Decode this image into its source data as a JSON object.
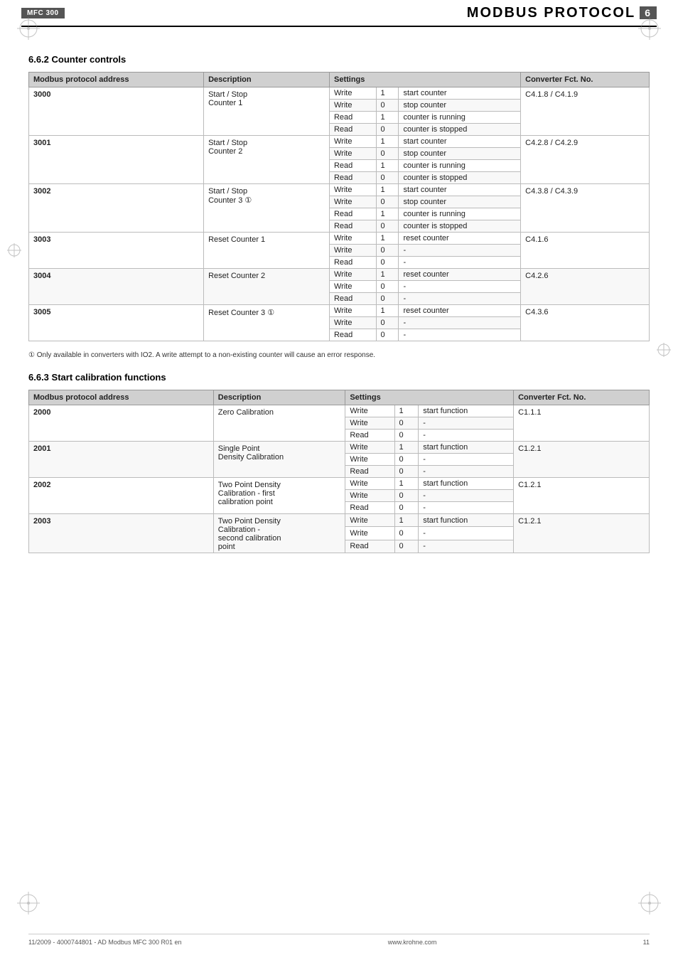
{
  "header": {
    "product": "MFC 300",
    "title": "MODBUS PROTOCOL",
    "badge": "6"
  },
  "section1": {
    "heading": "6.6.2  Counter controls",
    "table": {
      "columns": [
        "Modbus protocol address",
        "Description",
        "Settings",
        "",
        "",
        "Converter Fct. No."
      ],
      "rows": [
        {
          "address": "3000",
          "description": "Start / Stop\nCounter 1",
          "rows_inner": [
            {
              "rw": "Write",
              "val": "1",
              "desc": "start counter",
              "fct": "C4.1.8 / C4.1.9"
            },
            {
              "rw": "Write",
              "val": "0",
              "desc": "stop counter",
              "fct": ""
            },
            {
              "rw": "Read",
              "val": "1",
              "desc": "counter is running",
              "fct": ""
            },
            {
              "rw": "Read",
              "val": "0",
              "desc": "counter is stopped",
              "fct": ""
            }
          ]
        },
        {
          "address": "3001",
          "description": "Start / Stop\nCounter 2",
          "rows_inner": [
            {
              "rw": "Write",
              "val": "1",
              "desc": "start counter",
              "fct": "C4.2.8 / C4.2.9"
            },
            {
              "rw": "Write",
              "val": "0",
              "desc": "stop counter",
              "fct": ""
            },
            {
              "rw": "Read",
              "val": "1",
              "desc": "counter is running",
              "fct": ""
            },
            {
              "rw": "Read",
              "val": "0",
              "desc": "counter is stopped",
              "fct": ""
            }
          ]
        },
        {
          "address": "3002",
          "description": "Start / Stop\nCounter 3 ①",
          "rows_inner": [
            {
              "rw": "Write",
              "val": "1",
              "desc": "start counter",
              "fct": "C4.3.8 / C4.3.9"
            },
            {
              "rw": "Write",
              "val": "0",
              "desc": "stop counter",
              "fct": ""
            },
            {
              "rw": "Read",
              "val": "1",
              "desc": "counter is running",
              "fct": ""
            },
            {
              "rw": "Read",
              "val": "0",
              "desc": "counter is stopped",
              "fct": ""
            }
          ]
        },
        {
          "address": "3003",
          "description": "Reset Counter 1",
          "rows_inner": [
            {
              "rw": "Write",
              "val": "1",
              "desc": "reset counter",
              "fct": "C4.1.6"
            },
            {
              "rw": "Write",
              "val": "0",
              "desc": "-",
              "fct": ""
            },
            {
              "rw": "Read",
              "val": "0",
              "desc": "-",
              "fct": ""
            }
          ]
        },
        {
          "address": "3004",
          "description": "Reset Counter 2",
          "rows_inner": [
            {
              "rw": "Write",
              "val": "1",
              "desc": "reset counter",
              "fct": "C4.2.6"
            },
            {
              "rw": "Write",
              "val": "0",
              "desc": "-",
              "fct": ""
            },
            {
              "rw": "Read",
              "val": "0",
              "desc": "-",
              "fct": ""
            }
          ]
        },
        {
          "address": "3005",
          "description": "Reset Counter 3 ①",
          "rows_inner": [
            {
              "rw": "Write",
              "val": "1",
              "desc": "reset counter",
              "fct": "C4.3.6"
            },
            {
              "rw": "Write",
              "val": "0",
              "desc": "-",
              "fct": ""
            },
            {
              "rw": "Read",
              "val": "0",
              "desc": "-",
              "fct": ""
            }
          ]
        }
      ]
    },
    "footnote": "① Only available in converters with IO2. A write attempt to a non-existing counter will cause an error response."
  },
  "section2": {
    "heading": "6.6.3  Start calibration functions",
    "table": {
      "columns": [
        "Modbus protocol address",
        "Description",
        "Settings",
        "",
        "",
        "Converter Fct. No."
      ],
      "rows": [
        {
          "address": "2000",
          "description": "Zero Calibration",
          "rows_inner": [
            {
              "rw": "Write",
              "val": "1",
              "desc": "start function",
              "fct": "C1.1.1"
            },
            {
              "rw": "Write",
              "val": "0",
              "desc": "-",
              "fct": ""
            },
            {
              "rw": "Read",
              "val": "0",
              "desc": "-",
              "fct": ""
            }
          ]
        },
        {
          "address": "2001",
          "description": "Single Point\nDensity Calibration",
          "rows_inner": [
            {
              "rw": "Write",
              "val": "1",
              "desc": "start function",
              "fct": "C1.2.1"
            },
            {
              "rw": "Write",
              "val": "0",
              "desc": "-",
              "fct": ""
            },
            {
              "rw": "Read",
              "val": "0",
              "desc": "-",
              "fct": ""
            }
          ]
        },
        {
          "address": "2002",
          "description": "Two Point Density\nCalibration - first\ncalibration point",
          "rows_inner": [
            {
              "rw": "Write",
              "val": "1",
              "desc": "start function",
              "fct": "C1.2.1"
            },
            {
              "rw": "Write",
              "val": "0",
              "desc": "-",
              "fct": ""
            },
            {
              "rw": "Read",
              "val": "0",
              "desc": "-",
              "fct": ""
            }
          ]
        },
        {
          "address": "2003",
          "description": "Two Point Density\nCalibration -\nsecond calibration\npoint",
          "rows_inner": [
            {
              "rw": "Write",
              "val": "1",
              "desc": "start function",
              "fct": "C1.2.1"
            },
            {
              "rw": "Write",
              "val": "0",
              "desc": "-",
              "fct": ""
            },
            {
              "rw": "Read",
              "val": "0",
              "desc": "-",
              "fct": ""
            }
          ]
        }
      ]
    }
  },
  "footer": {
    "left": "11/2009 - 4000744801 - AD Modbus MFC 300 R01 en",
    "center": "www.krohne.com",
    "right": "11"
  },
  "col_headers": {
    "address": "Modbus protocol address",
    "description": "Description",
    "settings": "Settings",
    "converter": "Converter Fct. No."
  }
}
